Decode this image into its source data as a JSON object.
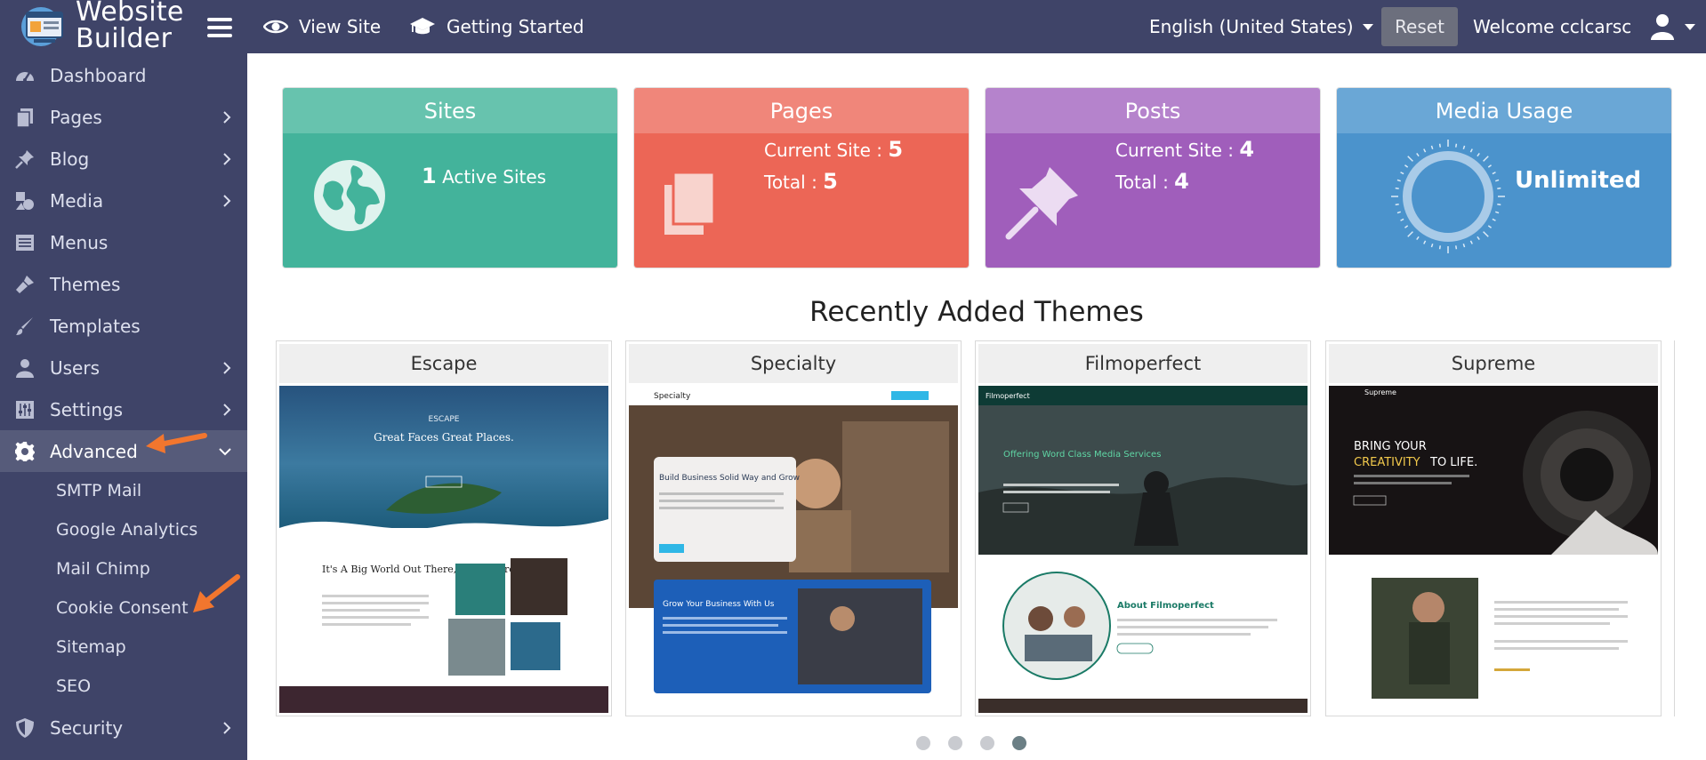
{
  "app": {
    "logo_line1": "Website",
    "logo_line2": "Builder"
  },
  "topnav": {
    "view_site": "View Site",
    "getting_started": "Getting Started",
    "language": "English (United States)",
    "reset": "Reset",
    "welcome": "Welcome cclcarsc"
  },
  "sidebar": {
    "items": [
      {
        "label": "Dashboard",
        "icon": "dashboard-icon"
      },
      {
        "label": "Pages",
        "icon": "pages-icon"
      },
      {
        "label": "Blog",
        "icon": "pin-icon"
      },
      {
        "label": "Media",
        "icon": "media-icon"
      },
      {
        "label": "Menus",
        "icon": "list-icon"
      },
      {
        "label": "Themes",
        "icon": "brush-icon"
      },
      {
        "label": "Templates",
        "icon": "paintbrush-icon"
      },
      {
        "label": "Users",
        "icon": "user-icon"
      },
      {
        "label": "Settings",
        "icon": "sliders-icon"
      },
      {
        "label": "Advanced",
        "icon": "gear-icon"
      },
      {
        "label": "Security",
        "icon": "shield-icon"
      }
    ],
    "advanced_sub": [
      "SMTP Mail",
      "Google Analytics",
      "Mail Chimp",
      "Cookie Consent",
      "Sitemap",
      "SEO"
    ]
  },
  "stats": {
    "sites": {
      "title": "Sites",
      "count": "1",
      "label": "Active Sites",
      "color": "#43b39b"
    },
    "pages": {
      "title": "Pages",
      "current_label": "Current Site : ",
      "current": "5",
      "total_label": "Total : ",
      "total": "5",
      "color": "#ec6656"
    },
    "posts": {
      "title": "Posts",
      "current_label": "Current Site : ",
      "current": "4",
      "total_label": "Total : ",
      "total": "4",
      "color": "#a05ebb"
    },
    "media": {
      "title": "Media Usage",
      "value": "Unlimited",
      "color": "#4b93cc"
    }
  },
  "themes": {
    "section_title": "Recently Added Themes",
    "items": [
      {
        "name": "Escape",
        "hero_heading": "ESCAPE",
        "hero_tagline": "Great Faces Great Places.",
        "about_heading": "It's A Big World Out There, Go Explore"
      },
      {
        "name": "Specialty",
        "hero_heading": "Build Business Solid Way and Grow",
        "about_heading": "Grow Your Business With Us",
        "nav_title": "Specialty"
      },
      {
        "name": "Filmoperfect",
        "hero_heading": "Offering Word Class Media Services",
        "about_heading": "About Filmoperfect",
        "nav_title": "Filmoperfect"
      },
      {
        "name": "Supreme",
        "hero_heading1": "BRING YOUR",
        "hero_heading2": "CREATIVITY",
        "hero_heading3": "TO LIFE.",
        "nav_title": "Supreme"
      }
    ]
  },
  "carousel": {
    "pages": 4,
    "active_index": 3
  }
}
